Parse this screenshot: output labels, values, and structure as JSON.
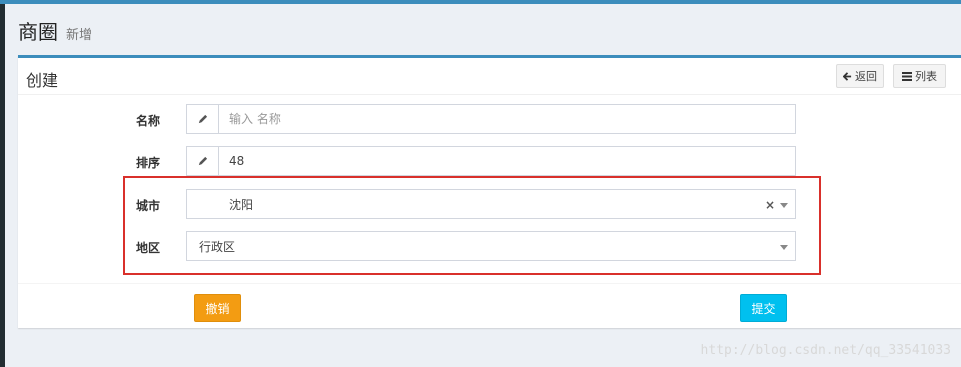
{
  "header": {
    "title": "商圈",
    "subtitle": "新增"
  },
  "box": {
    "title": "创建",
    "tools": {
      "back_label": "返回",
      "list_label": "列表"
    }
  },
  "form": {
    "name": {
      "label": "名称",
      "value": "",
      "placeholder": "输入 名称",
      "icon": "pencil-icon"
    },
    "order": {
      "label": "排序",
      "value": "48",
      "placeholder": "",
      "icon": "pencil-icon"
    },
    "city": {
      "label": "城市",
      "selected": "沈阳",
      "clear": "×"
    },
    "region": {
      "label": "地区",
      "selected": "行政区"
    }
  },
  "footer": {
    "cancel_label": "撤销",
    "submit_label": "提交"
  },
  "watermark": "http://blog.csdn.net/qq_33541033",
  "colors": {
    "primary": "#3c8dbc",
    "warning": "#f39c12",
    "info": "#00c0ef",
    "highlight": "#d9302b"
  }
}
